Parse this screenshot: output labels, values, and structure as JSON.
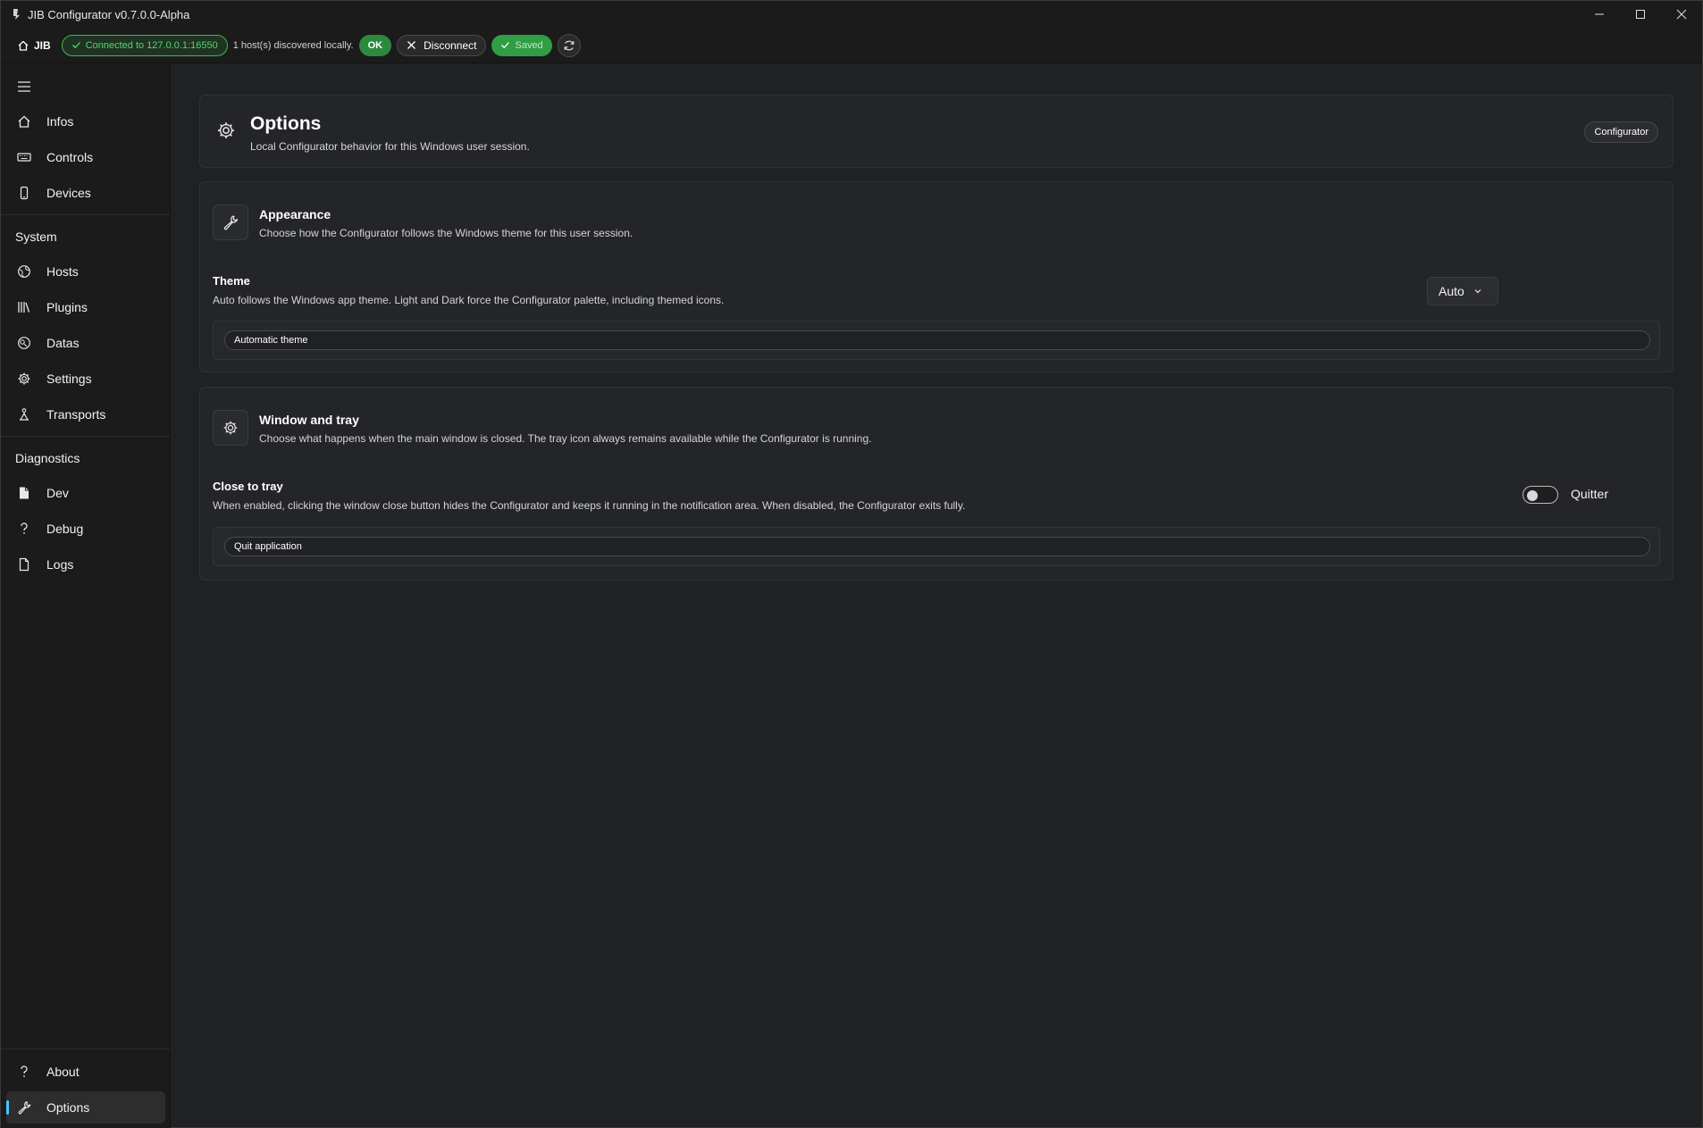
{
  "window": {
    "title": "JIB Configurator v0.7.0.0-Alpha"
  },
  "toolbar": {
    "home_label": "JIB",
    "connection_label": "Connected to 127.0.0.1:16550",
    "discovery_text": "1 host(s) discovered locally.",
    "ok_label": "OK",
    "disconnect_label": "Disconnect",
    "saved_label": "Saved"
  },
  "sidebar": {
    "top_items": [
      {
        "label": "Infos",
        "icon": "home-icon"
      },
      {
        "label": "Controls",
        "icon": "keyboard-icon"
      },
      {
        "label": "Devices",
        "icon": "phone-icon"
      }
    ],
    "section_system": "System",
    "system_items": [
      {
        "label": "Hosts",
        "icon": "globe-icon"
      },
      {
        "label": "Plugins",
        "icon": "library-icon"
      },
      {
        "label": "Datas",
        "icon": "database-icon"
      },
      {
        "label": "Settings",
        "icon": "gear-icon"
      },
      {
        "label": "Transports",
        "icon": "person-icon"
      }
    ],
    "section_diagnostics": "Diagnostics",
    "diagnostics_items": [
      {
        "label": "Dev",
        "icon": "document-icon"
      },
      {
        "label": "Debug",
        "icon": "question-icon"
      },
      {
        "label": "Logs",
        "icon": "page-icon"
      }
    ],
    "bottom_items": [
      {
        "label": "About",
        "icon": "question-icon"
      },
      {
        "label": "Options",
        "icon": "wrench-icon",
        "active": true
      }
    ]
  },
  "header": {
    "title": "Options",
    "subtitle": "Local Configurator behavior for this Windows user session.",
    "button_label": "Configurator"
  },
  "appearance": {
    "title": "Appearance",
    "subtitle": "Choose how the Configurator follows the Windows theme for this user session.",
    "setting_title": "Theme",
    "setting_desc": "Auto follows the Windows app theme. Light and Dark force the Configurator palette, including themed icons.",
    "dropdown_value": "Auto",
    "status_text": "Automatic theme"
  },
  "tray": {
    "title": "Window and tray",
    "subtitle": "Choose what happens when the main window is closed. The tray icon always remains available while the Configurator is running.",
    "setting_title": "Close to tray",
    "setting_desc": "When enabled, clicking the window close button hides the Configurator and keeps it running in the notification area. When disabled, the Configurator exits fully.",
    "toggle_label": "Quitter",
    "toggle_on": false,
    "status_text": "Quit application"
  },
  "colors": {
    "accent": "#4cc2ff",
    "success": "#2f9e44",
    "connected_text": "#58d66d",
    "background": "#202124",
    "sidebar": "#1b1b1b"
  }
}
